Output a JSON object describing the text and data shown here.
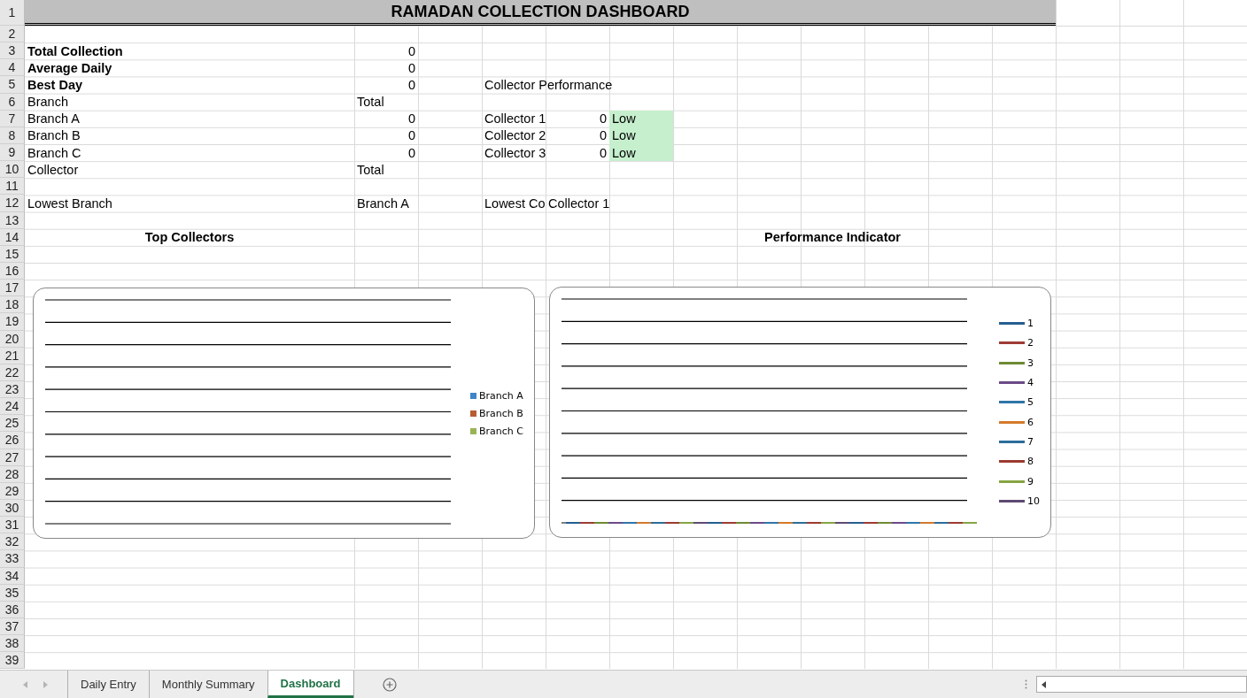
{
  "sheet": {
    "rows": [
      {
        "number": "1",
        "cells": [
          {
            "kind": "title",
            "colspan": 12,
            "text": "RAMADAN COLLECTION DASHBOARD"
          }
        ]
      },
      {
        "number": "2",
        "cells": []
      },
      {
        "number": "3",
        "cells": [
          {
            "kind": "label",
            "bold": true,
            "text": "Total Collection"
          },
          {
            "kind": "number",
            "text": "0"
          }
        ]
      },
      {
        "number": "4",
        "cells": [
          {
            "kind": "label",
            "bold": true,
            "text": "Average Daily"
          },
          {
            "kind": "number",
            "text": "0"
          }
        ]
      },
      {
        "number": "5",
        "cells": [
          {
            "kind": "label",
            "bold": true,
            "text": "Best Day"
          },
          {
            "kind": "number",
            "text": "0"
          },
          "",
          {
            "kind": "label",
            "text": "Collector Performance"
          }
        ]
      },
      {
        "number": "6",
        "cells": [
          {
            "kind": "label",
            "text": "Branch"
          },
          {
            "kind": "label",
            "text": "Total"
          }
        ]
      },
      {
        "number": "7",
        "cells": [
          {
            "kind": "label",
            "text": "Branch A"
          },
          {
            "kind": "number",
            "text": "0"
          },
          "",
          {
            "kind": "label",
            "text": "Collector 1"
          },
          {
            "kind": "number",
            "text": "0"
          },
          {
            "kind": "status",
            "color": "#c6efce",
            "text": "Low"
          }
        ]
      },
      {
        "number": "8",
        "cells": [
          {
            "kind": "label",
            "text": "Branch B"
          },
          {
            "kind": "number",
            "text": "0"
          },
          "",
          {
            "kind": "label",
            "text": "Collector 2"
          },
          {
            "kind": "number",
            "text": "0"
          },
          {
            "kind": "status",
            "color": "#c6efce",
            "text": "Low"
          }
        ]
      },
      {
        "number": "9",
        "cells": [
          {
            "kind": "label",
            "text": "Branch C"
          },
          {
            "kind": "number",
            "text": "0"
          },
          "",
          {
            "kind": "label",
            "text": "Collector 3"
          },
          {
            "kind": "number",
            "text": "0"
          },
          {
            "kind": "status",
            "color": "#c6efce",
            "text": "Low"
          }
        ]
      },
      {
        "number": "10",
        "cells": [
          {
            "kind": "label",
            "text": "Collector"
          },
          {
            "kind": "label",
            "text": "Total"
          }
        ]
      },
      {
        "number": "11",
        "cells": []
      },
      {
        "number": "12",
        "cells": [
          {
            "kind": "label",
            "text": "Lowest Branch"
          },
          {
            "kind": "label",
            "text": "Branch A"
          },
          "",
          {
            "kind": "label",
            "text": "Lowest Co"
          },
          {
            "kind": "label",
            "text": "Collector 1"
          }
        ]
      },
      {
        "number": "13",
        "cells": []
      },
      {
        "number": "14",
        "cells": [
          {
            "kind": "heading",
            "text": "Top Collectors"
          },
          "",
          "",
          "",
          "",
          "",
          "",
          "",
          {
            "kind": "heading",
            "text": "Performance Indicator"
          }
        ]
      },
      {
        "number": "15",
        "cells": []
      },
      {
        "number": "16",
        "cells": []
      },
      {
        "number": "17",
        "cells": []
      },
      {
        "number": "18",
        "cells": []
      },
      {
        "number": "19",
        "cells": []
      },
      {
        "number": "20",
        "cells": []
      },
      {
        "number": "21",
        "cells": []
      },
      {
        "number": "22",
        "cells": []
      },
      {
        "number": "23",
        "cells": []
      },
      {
        "number": "24",
        "cells": []
      },
      {
        "number": "25",
        "cells": []
      },
      {
        "number": "26",
        "cells": []
      },
      {
        "number": "27",
        "cells": []
      },
      {
        "number": "28",
        "cells": []
      },
      {
        "number": "29",
        "cells": []
      },
      {
        "number": "30",
        "cells": []
      },
      {
        "number": "31",
        "cells": []
      },
      {
        "number": "32",
        "cells": []
      },
      {
        "number": "33",
        "cells": []
      },
      {
        "number": "34",
        "cells": []
      },
      {
        "number": "35",
        "cells": []
      },
      {
        "number": "36",
        "cells": []
      },
      {
        "number": "37",
        "cells": []
      },
      {
        "number": "38",
        "cells": []
      },
      {
        "number": "39",
        "cells": []
      }
    ]
  },
  "charts": [
    {
      "kind": "bar",
      "legend": [
        {
          "label": "Branch A",
          "color": "#3f85c8"
        },
        {
          "label": "Branch B",
          "color": "#b85c32"
        },
        {
          "label": "Branch C",
          "color": "#98b455"
        }
      ]
    },
    {
      "kind": "line",
      "legend": [
        {
          "label": "1",
          "color": "#255e91"
        },
        {
          "label": "2",
          "color": "#9e3b34"
        },
        {
          "label": "3",
          "color": "#6f8a34"
        },
        {
          "label": "4",
          "color": "#6b4a87"
        },
        {
          "label": "5",
          "color": "#2f75a8"
        },
        {
          "label": "6",
          "color": "#d37a2b"
        },
        {
          "label": "7",
          "color": "#2c6d9a"
        },
        {
          "label": "8",
          "color": "#9b3a30"
        },
        {
          "label": "9",
          "color": "#86a443"
        },
        {
          "label": "10",
          "color": "#5e4a74"
        }
      ]
    }
  ],
  "sheet_tabs": [
    {
      "label": "Daily Entry",
      "selected": false
    },
    {
      "label": "Monthly Summary",
      "selected": false
    },
    {
      "label": "Dashboard",
      "selected": true
    }
  ]
}
